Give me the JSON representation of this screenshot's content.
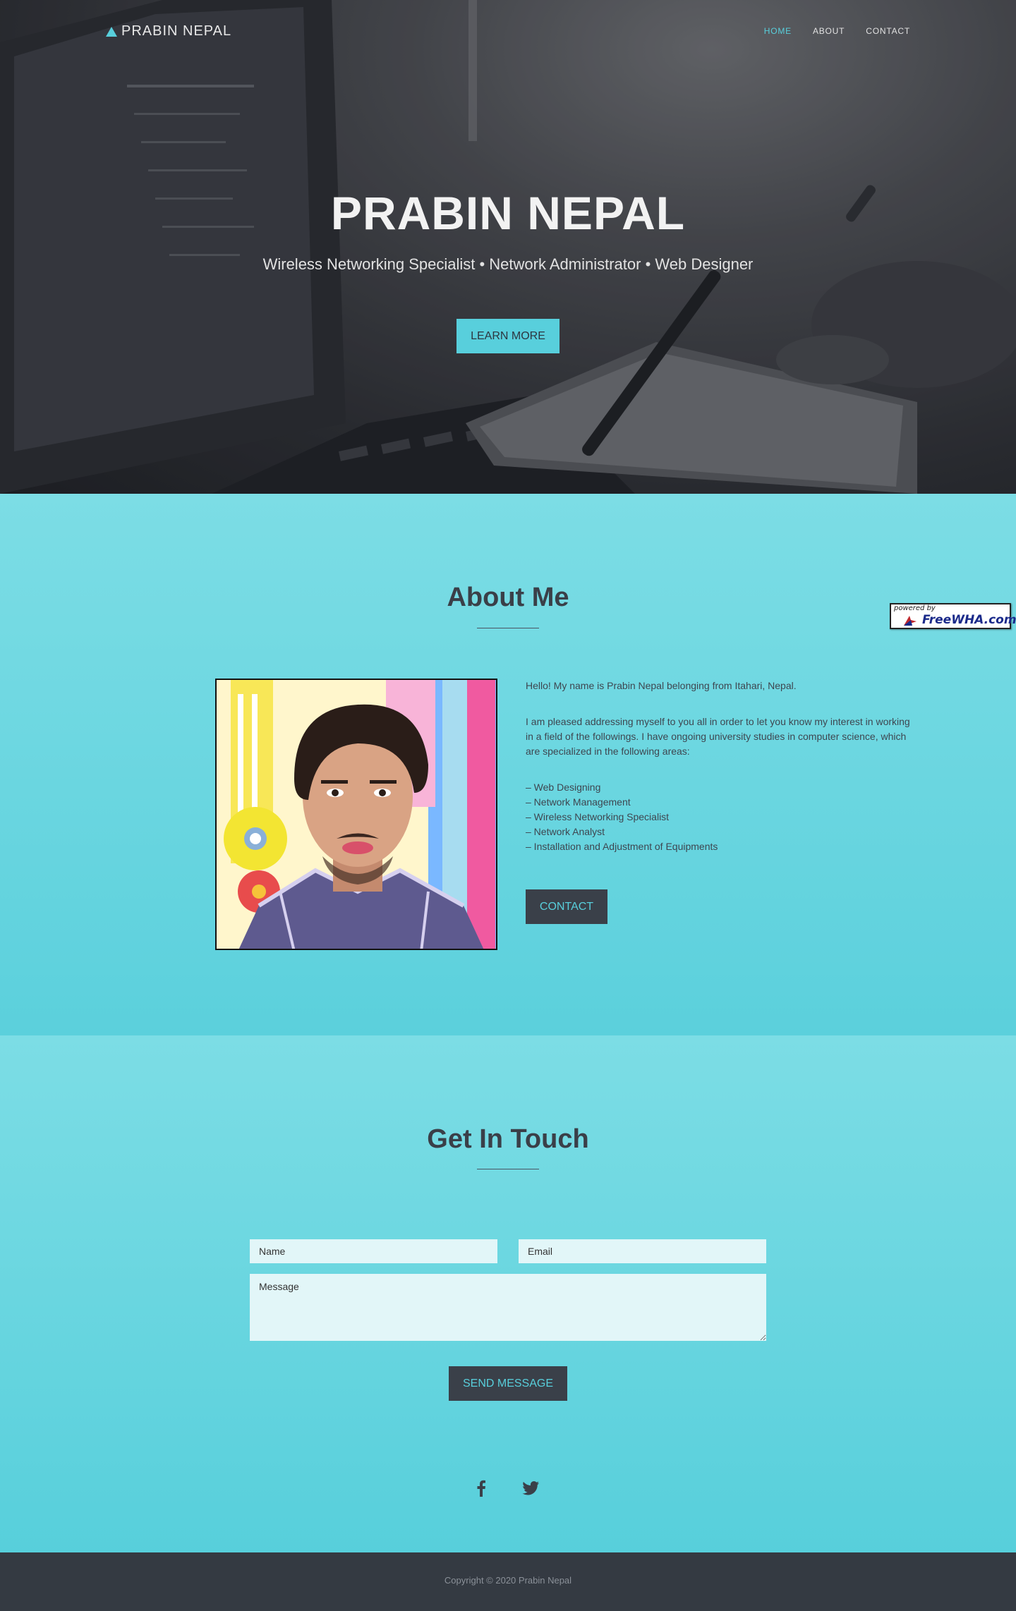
{
  "brand": {
    "name": "PRABIN NEPAL",
    "icon": "triangle-logo-icon"
  },
  "nav": {
    "links": [
      "HOME",
      "ABOUT",
      "CONTACT"
    ],
    "active": "HOME"
  },
  "hero": {
    "title": "PRABIN NEPAL",
    "subtitle": "Wireless Networking Specialist • Network Administrator • Web Designer",
    "button_label": "LEARN MORE"
  },
  "about": {
    "title": "About Me",
    "photo_alt": "profile-photo",
    "intro": "Hello! My name is Prabin Nepal belonging from Itahari, Nepal.",
    "paragraph": "I am pleased addressing myself to you all in order to let you know my interest in working in a field of the followings. I have ongoing university studies in computer science, which are specialized in the following areas:",
    "skills": [
      "– Web Designing",
      "– Network Management",
      "– Wireless Networking Specialist",
      "– Network Analyst",
      "– Installation and Adjustment of Equipments"
    ],
    "button_label": "CONTACT"
  },
  "badge": {
    "small": "powered by",
    "main": "FreeWHA.com"
  },
  "contact": {
    "title": "Get In Touch",
    "name_placeholder": "Name",
    "email_placeholder": "Email",
    "message_placeholder": "Message",
    "button_label": "SEND MESSAGE"
  },
  "social": {
    "icons": [
      "facebook-icon",
      "twitter-icon"
    ]
  },
  "footer": {
    "copyright": "Copyright © 2020 Prabin Nepal"
  },
  "colors": {
    "accent": "#58cfdc",
    "dark": "#343a42",
    "button_dark": "#3a4049"
  }
}
